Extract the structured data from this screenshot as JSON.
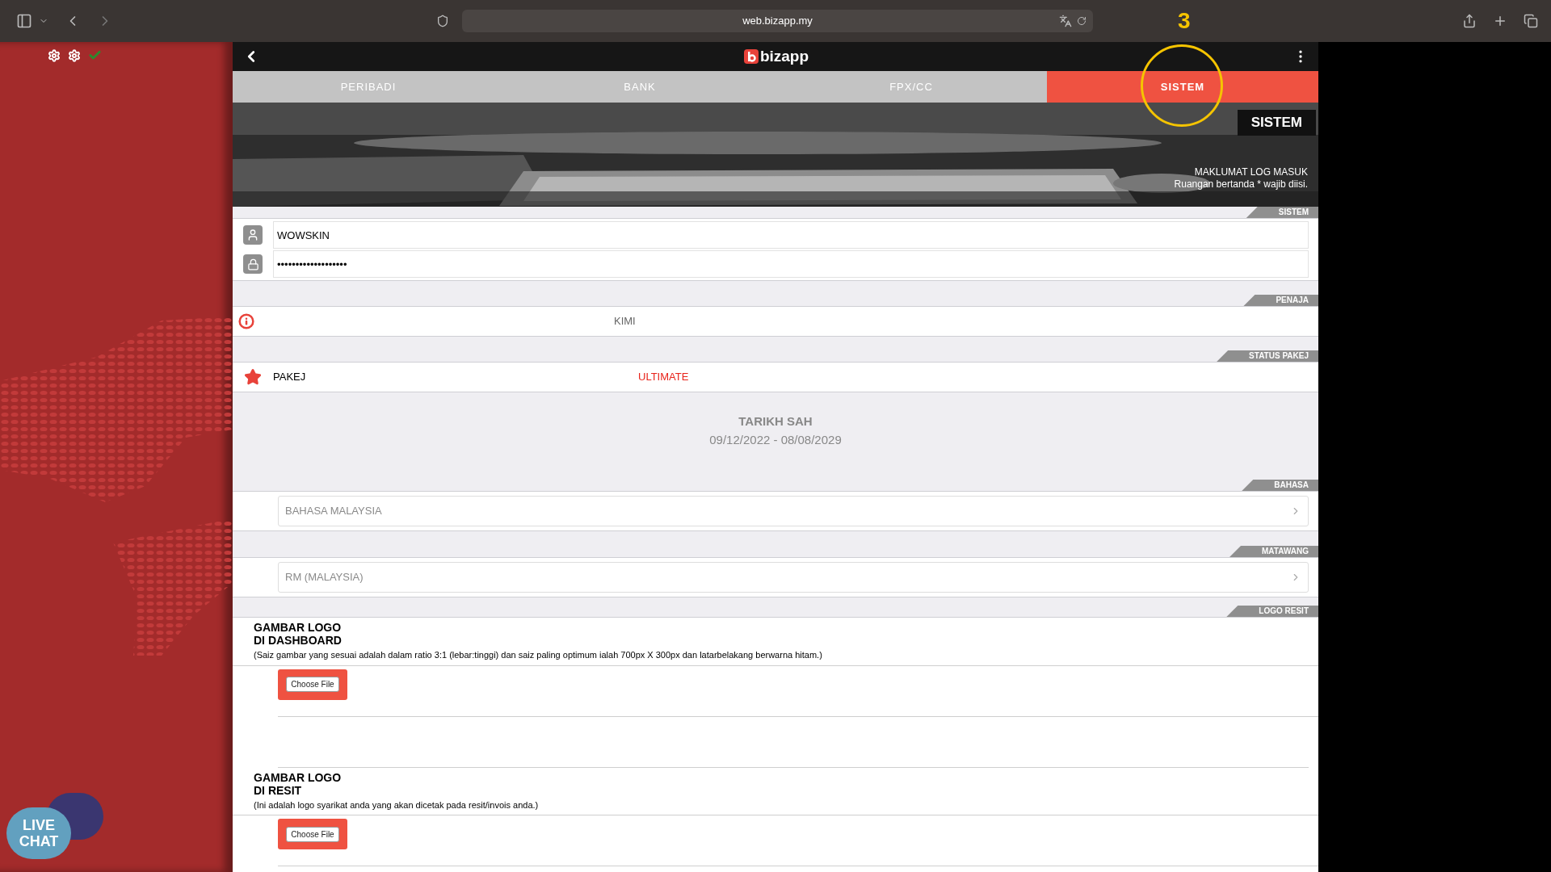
{
  "browser": {
    "url": "web.bizapp.my"
  },
  "annotation": {
    "label": "3"
  },
  "sidebar": {
    "live_chat": "LIVE\nCHAT"
  },
  "header": {
    "logo": "bizapp"
  },
  "tabs": [
    {
      "label": "PERIBADI",
      "selected": false
    },
    {
      "label": "BANK",
      "selected": false
    },
    {
      "label": "FPX/CC",
      "selected": false
    },
    {
      "label": "SISTEM",
      "selected": true
    }
  ],
  "banner": {
    "badge": "SISTEM",
    "title": "MAKLUMAT LOG MASUK",
    "note": "Ruangan bertanda * wajib diisi."
  },
  "login": {
    "tag": "SISTEM",
    "username": "WOWSKIN",
    "password": "•••••••••••••••••••"
  },
  "penaja": {
    "tag": "PENAJA",
    "value": "KIMI"
  },
  "pakej": {
    "tag": "STATUS PAKEJ",
    "label": "PAKEJ",
    "value": "ULTIMATE",
    "validity_title": "TARIKH SAH",
    "validity": "09/12/2022 - 08/08/2029"
  },
  "bahasa": {
    "tag": "BAHASA",
    "value": "BAHASA MALAYSIA"
  },
  "matawang": {
    "tag": "MATAWANG",
    "value": "RM (MALAYSIA)"
  },
  "logo_resit": {
    "tag": "LOGO RESIT",
    "uploads": [
      {
        "title": "GAMBAR LOGO\nDI DASHBOARD",
        "hint": "(Saiz gambar yang sesuai adalah dalam ratio 3:1 (lebar:tinggi) dan saiz paling optimum ialah 700px X 300px dan latarbelakang berwarna hitam.)",
        "button": "Choose File"
      },
      {
        "title": "GAMBAR LOGO\nDI RESIT",
        "hint": "(Ini adalah logo syarikat anda yang akan dicetak pada resit/invois anda.)",
        "button": "Choose File"
      }
    ]
  }
}
